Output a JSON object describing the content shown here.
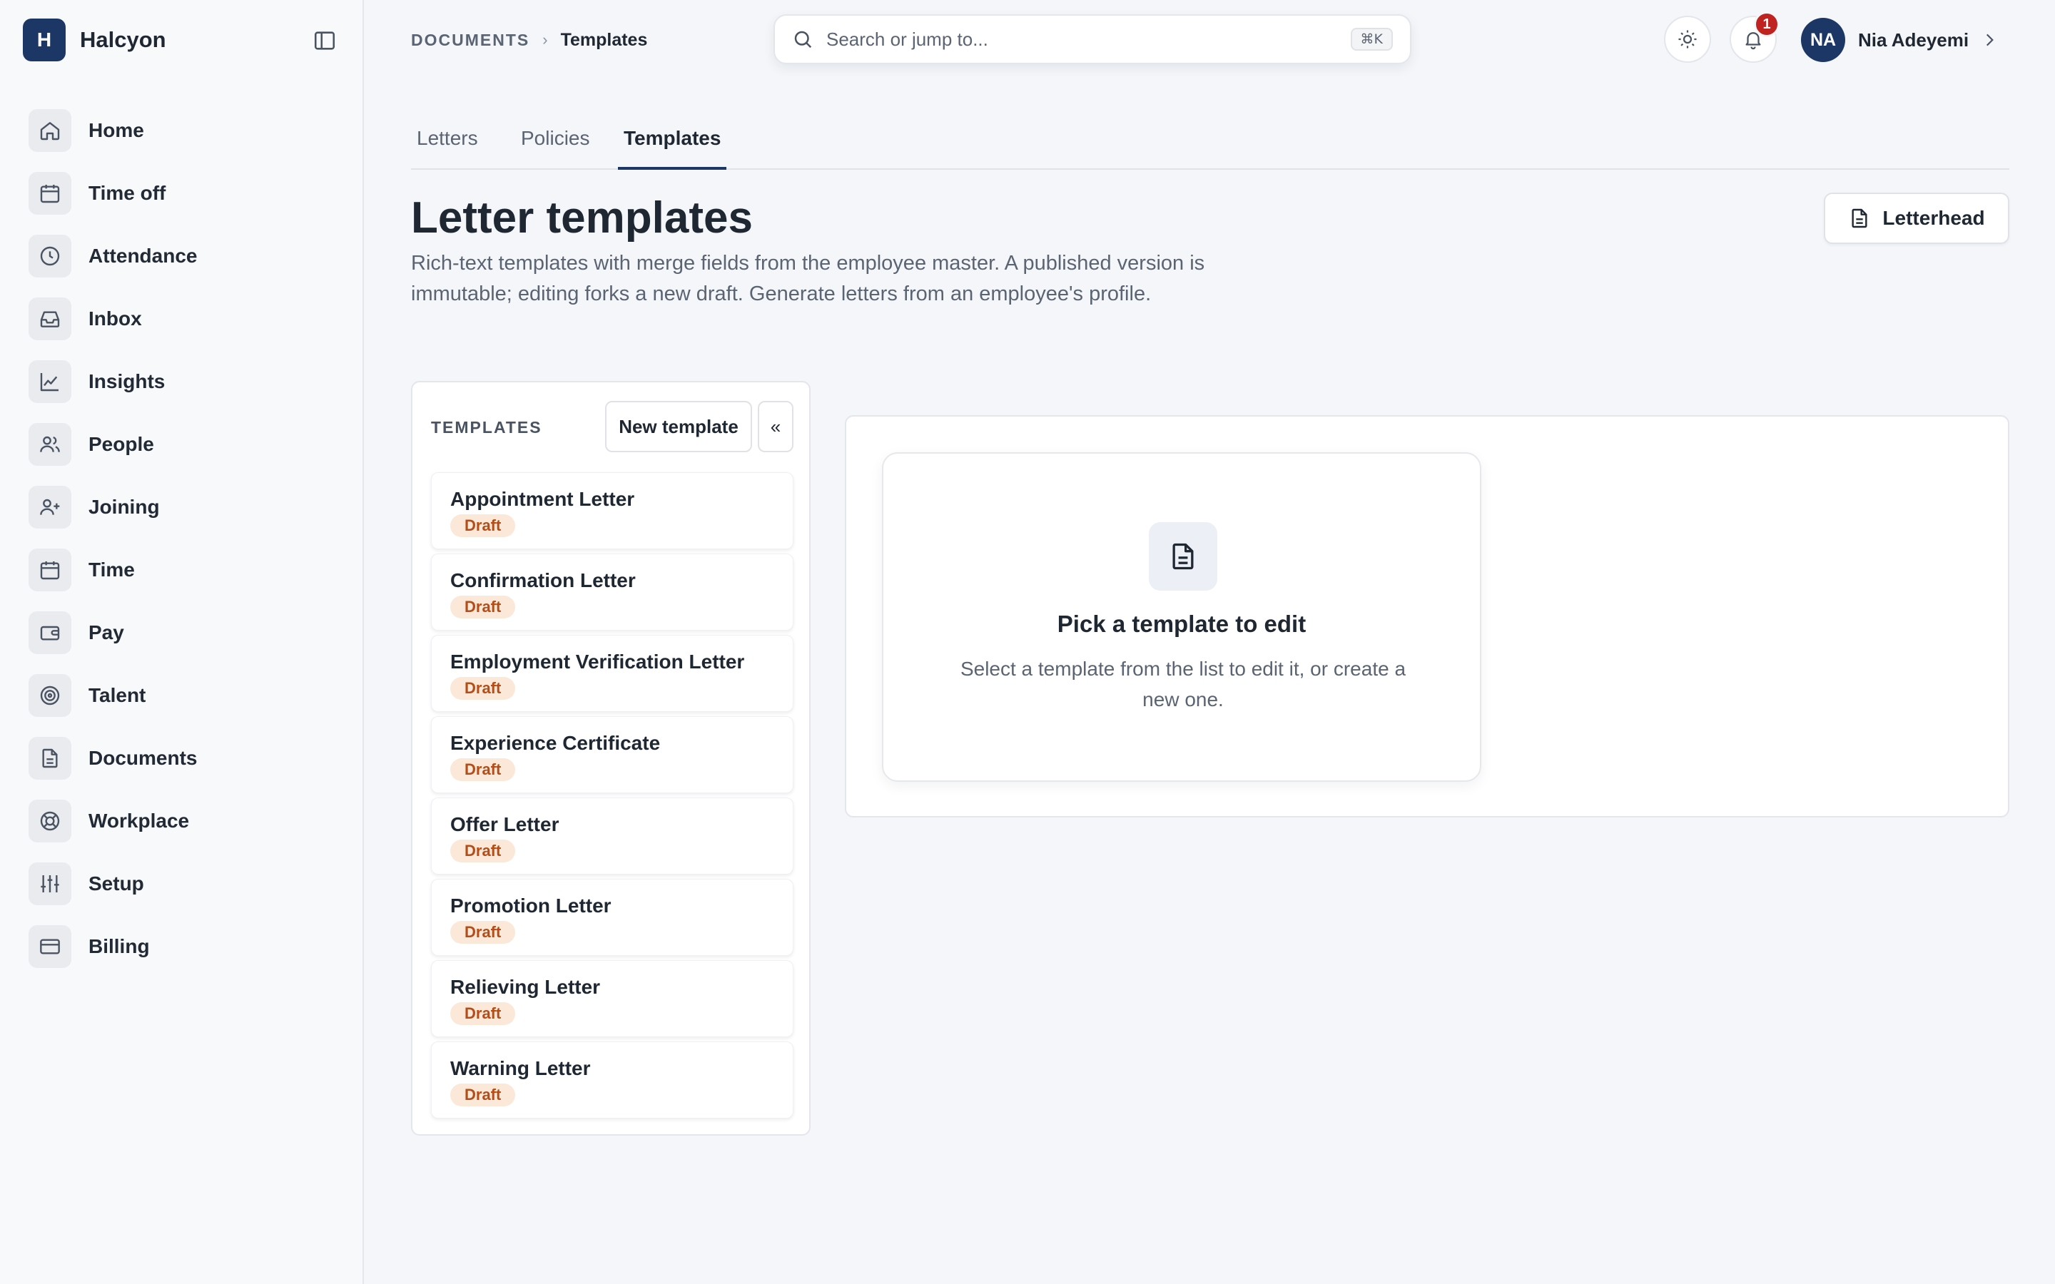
{
  "app": {
    "name": "Halcyon",
    "logo_letter": "H"
  },
  "sidebar": {
    "items": [
      {
        "label": "Home",
        "icon": "home-icon"
      },
      {
        "label": "Time off",
        "icon": "calendar-icon"
      },
      {
        "label": "Attendance",
        "icon": "clock-icon"
      },
      {
        "label": "Inbox",
        "icon": "inbox-icon"
      },
      {
        "label": "Insights",
        "icon": "line-chart-icon"
      },
      {
        "label": "People",
        "icon": "users-icon"
      },
      {
        "label": "Joining",
        "icon": "user-plus-icon"
      },
      {
        "label": "Time",
        "icon": "calendar-icon"
      },
      {
        "label": "Pay",
        "icon": "wallet-icon"
      },
      {
        "label": "Talent",
        "icon": "target-icon"
      },
      {
        "label": "Documents",
        "icon": "file-text-icon"
      },
      {
        "label": "Workplace",
        "icon": "life-buoy-icon"
      },
      {
        "label": "Setup",
        "icon": "sliders-icon"
      },
      {
        "label": "Billing",
        "icon": "credit-card-icon"
      }
    ]
  },
  "breadcrumb": {
    "parent": "DOCUMENTS",
    "separator": "›",
    "current": "Templates"
  },
  "search": {
    "placeholder": "Search or jump to...",
    "shortcut": "⌘K"
  },
  "header": {
    "notifications_count": "1",
    "user_initials": "NA",
    "user_name": "Nia Adeyemi"
  },
  "tabs": [
    {
      "label": "Letters",
      "active": false
    },
    {
      "label": "Policies",
      "active": false
    },
    {
      "label": "Templates",
      "active": true
    }
  ],
  "page": {
    "title": "Letter templates",
    "description": "Rich-text templates with merge fields from the employee master. A published version is immutable; editing forks a new draft. Generate letters from an employee's profile.",
    "letterhead_label": "Letterhead"
  },
  "templates_panel": {
    "heading": "TEMPLATES",
    "new_button": "New template",
    "collapse_label": "«",
    "items": [
      {
        "name": "Appointment Letter",
        "status": "Draft"
      },
      {
        "name": "Confirmation Letter",
        "status": "Draft"
      },
      {
        "name": "Employment Verification Letter",
        "status": "Draft"
      },
      {
        "name": "Experience Certificate",
        "status": "Draft"
      },
      {
        "name": "Offer Letter",
        "status": "Draft"
      },
      {
        "name": "Promotion Letter",
        "status": "Draft"
      },
      {
        "name": "Relieving Letter",
        "status": "Draft"
      },
      {
        "name": "Warning Letter",
        "status": "Draft"
      }
    ]
  },
  "empty_state": {
    "title": "Pick a template to edit",
    "text": "Select a template from the list to edit it, or create a new one."
  },
  "colors": {
    "brand": "#1c3766",
    "badge_alert": "#c0231f",
    "draft_bg": "#fbe8d8",
    "draft_text": "#b54d18"
  }
}
